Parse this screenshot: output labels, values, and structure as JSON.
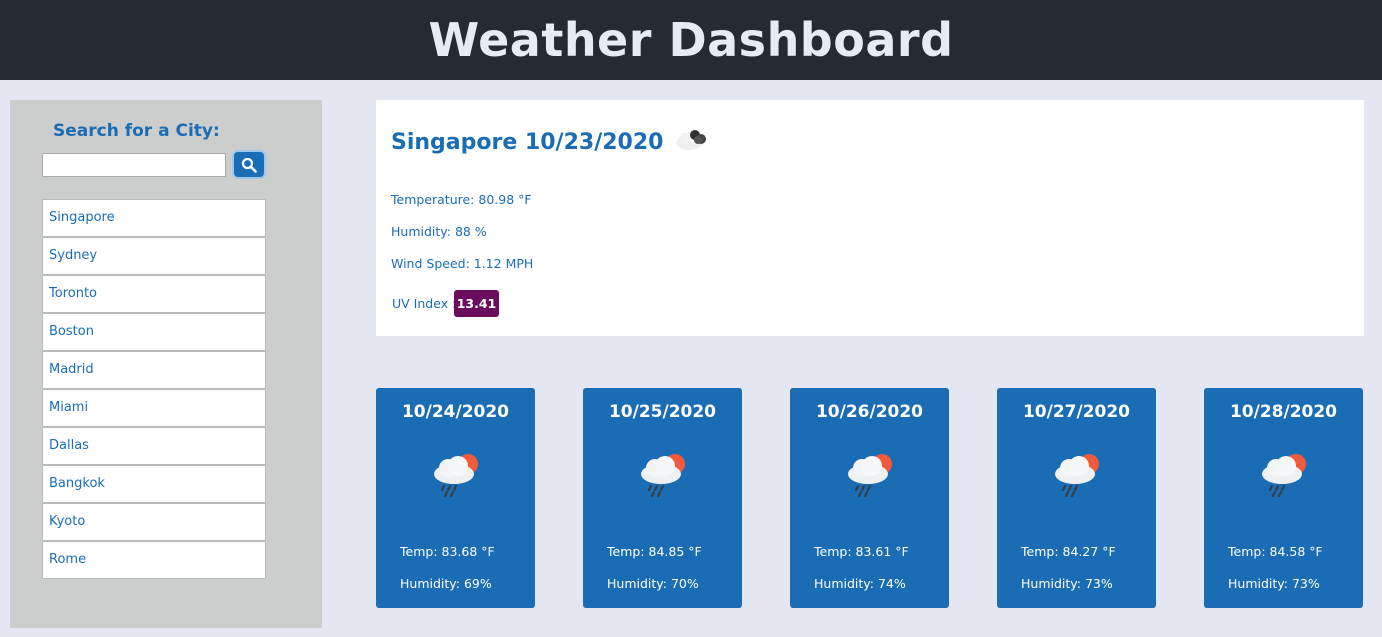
{
  "header": {
    "title": "Weather Dashboard"
  },
  "search": {
    "title": "Search for a City:",
    "placeholder": ""
  },
  "cities": [
    "Singapore",
    "Sydney",
    "Toronto",
    "Boston",
    "Madrid",
    "Miami",
    "Dallas",
    "Bangkok",
    "Kyoto",
    "Rome"
  ],
  "current": {
    "heading": "Singapore 10/23/2020",
    "temperature": "Temperature: 80.98 °F",
    "humidity": "Humidity: 88 %",
    "wind": "Wind Speed: 1.12 MPH",
    "uv_label": "UV Index :",
    "uv_value": "13.41",
    "icon": "scattered-clouds-icon"
  },
  "forecast": [
    {
      "date": "10/24/2020",
      "temp": "Temp: 83.68 °F",
      "humidity": "Humidity: 69%",
      "icon": "rain-sun-icon"
    },
    {
      "date": "10/25/2020",
      "temp": "Temp: 84.85 °F",
      "humidity": "Humidity: 70%",
      "icon": "rain-sun-icon"
    },
    {
      "date": "10/26/2020",
      "temp": "Temp: 83.61 °F",
      "humidity": "Humidity: 74%",
      "icon": "rain-sun-icon"
    },
    {
      "date": "10/27/2020",
      "temp": "Temp: 84.27 °F",
      "humidity": "Humidity: 73%",
      "icon": "rain-sun-icon"
    },
    {
      "date": "10/28/2020",
      "temp": "Temp: 84.58 °F",
      "humidity": "Humidity: 73%",
      "icon": "rain-sun-icon"
    }
  ],
  "colors": {
    "header_bg": "#262b33",
    "accent": "#1a6db5",
    "uv_badge": "#6c0c5c",
    "page_bg": "#e4e6f2"
  }
}
